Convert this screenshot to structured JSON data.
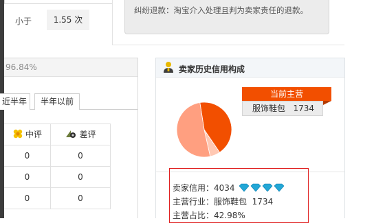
{
  "top_left": {
    "label": "小于",
    "value": "1.55 次"
  },
  "dispute": {
    "text": "纠纷退款：淘宝介入处理且判为卖家责任的退款。"
  },
  "left_panel": {
    "rate_percent": "96.84%",
    "tabs": [
      "近半年",
      "半年以前"
    ],
    "columns": [
      {
        "label": "中评",
        "icon": "neutral-rating-icon"
      },
      {
        "label": "差评",
        "icon": "negative-rating-icon"
      }
    ],
    "rows": [
      [
        "0",
        "0"
      ],
      [
        "0",
        "0"
      ],
      [
        "0",
        "0"
      ]
    ]
  },
  "right_panel": {
    "title": "卖家历史信用构成",
    "icon": "seller-person-icon",
    "main_business_label": "当前主营",
    "main_category": "服饰鞋包",
    "main_category_count": "1734",
    "pie": {
      "slices": [
        {
          "share": 0.4298,
          "color": "#f24f00"
        },
        {
          "share": 0.06,
          "color": "#ffc8b3"
        },
        {
          "share": 0.5102,
          "color": "#ff9f80"
        }
      ]
    },
    "credit_label": "卖家信用：",
    "credit_value": "4034",
    "credit_diamonds": 4,
    "industry_label": "主营行业：",
    "industry_value": "服饰鞋包",
    "industry_count": "1734",
    "share_label": "主营占比：",
    "share_value": "42.98%"
  },
  "colors": {
    "accent": "#f24f00",
    "highlight_border": "#e02020",
    "diamond": "#23a7d6"
  }
}
